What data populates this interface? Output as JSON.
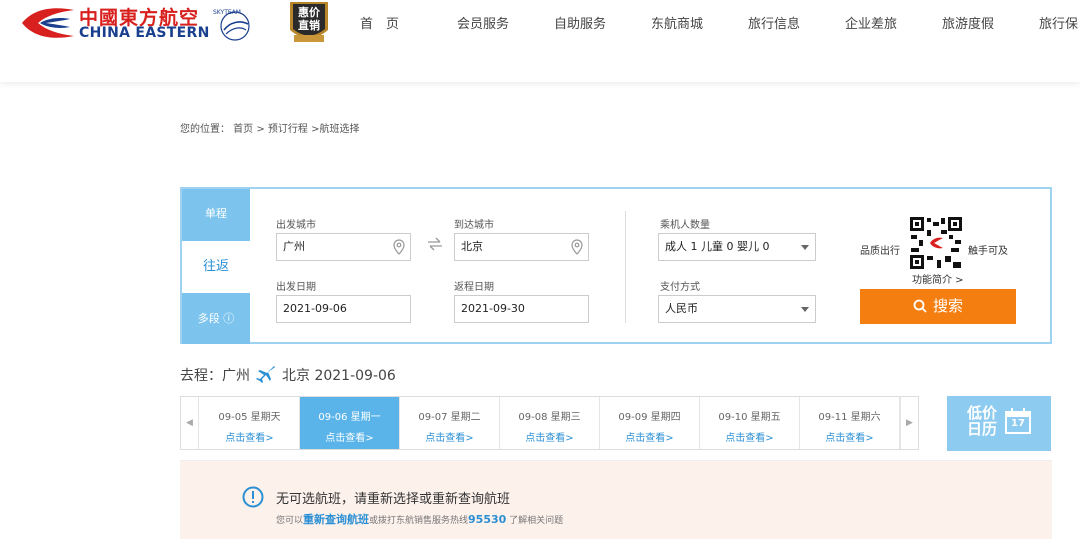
{
  "header": {
    "logo_cn": "中國東方航空",
    "logo_en": "CHINA EASTERN",
    "badge": "惠价\n直销",
    "nav": [
      "首　页",
      "会员服务",
      "自助服务",
      "东航商城",
      "旅行信息",
      "企业差旅",
      "旅游度假",
      "旅行保"
    ]
  },
  "breadcrumb": "您的位置：  首页 > 预订行程 >航班选择",
  "search": {
    "tabs": {
      "oneway": "单程",
      "round": "往返",
      "multi": "多段 ⓘ"
    },
    "depart_city_label": "出发城市",
    "depart_city": "广州",
    "arrive_city_label": "到达城市",
    "arrive_city": "北京",
    "depart_date_label": "出发日期",
    "depart_date": "2021-09-06",
    "return_date_label": "返程日期",
    "return_date": "2021-09-30",
    "passengers_label": "乘机人数量",
    "passengers": "成人 1  儿童 0  婴儿 0",
    "payment_label": "支付方式",
    "payment": "人民币",
    "qr_left": "品质出行",
    "qr_right": "触手可及",
    "qr_link": "功能简介 >",
    "search_button": "搜索"
  },
  "route": {
    "prefix": "去程：",
    "from": "广州",
    "to_date": "北京 2021-09-06"
  },
  "dates": [
    {
      "date": "09-05 星期天",
      "action": "点击查看>",
      "active": false
    },
    {
      "date": "09-06 星期一",
      "action": "点击查看>",
      "active": true
    },
    {
      "date": "09-07 星期二",
      "action": "点击查看>",
      "active": false
    },
    {
      "date": "09-08 星期三",
      "action": "点击查看>",
      "active": false
    },
    {
      "date": "09-09 星期四",
      "action": "点击查看>",
      "active": false
    },
    {
      "date": "09-10 星期五",
      "action": "点击查看>",
      "active": false
    },
    {
      "date": "09-11 星期六",
      "action": "点击查看>",
      "active": false
    }
  ],
  "low_price": {
    "label": "低价\n日历",
    "calendar_day": "17"
  },
  "notice": {
    "title": "无可选航班，请重新选择或重新查询航班",
    "sub_prefix": "您可以",
    "sub_link": "重新查询航班",
    "sub_mid": "或拨打东航销售服务热线",
    "hotline": "95530",
    "sub_suffix": " 了解相关问题"
  },
  "colors": {
    "brand_red": "#d8201e",
    "brand_blue": "#1a3f8f",
    "accent": "#5ab4ea",
    "search_orange": "#f57e10"
  }
}
